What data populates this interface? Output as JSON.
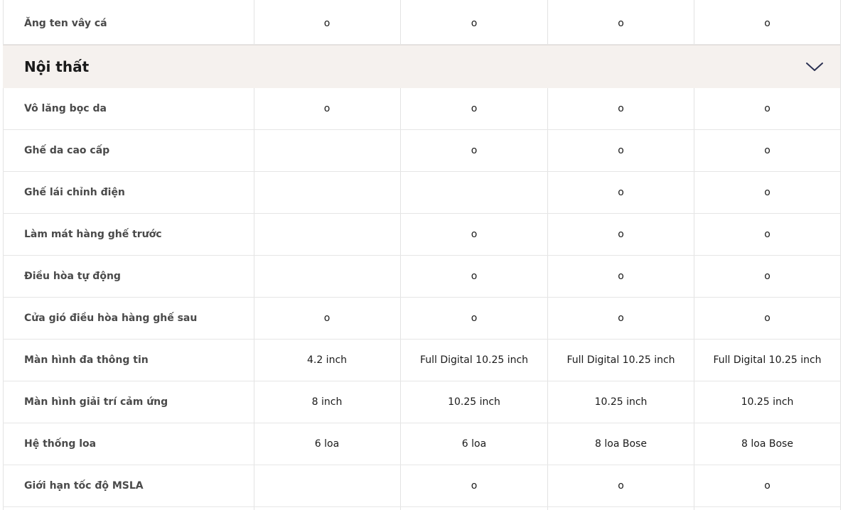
{
  "top_row": {
    "label": "Ăng ten vây cá",
    "values": [
      "o",
      "o",
      "o",
      "o"
    ]
  },
  "section": {
    "title": "Nội thất",
    "toggle_icon": "chevron-down-icon",
    "accent": "#2b3152"
  },
  "rows": [
    {
      "label": "Vô lăng bọc da",
      "values": [
        "o",
        "o",
        "o",
        "o"
      ]
    },
    {
      "label": "Ghế da cao cấp",
      "values": [
        "",
        "o",
        "o",
        "o"
      ]
    },
    {
      "label": "Ghế lái chỉnh điện",
      "values": [
        "",
        "",
        "o",
        "o"
      ]
    },
    {
      "label": "Làm mát hàng ghế trước",
      "values": [
        "",
        "o",
        "o",
        "o"
      ]
    },
    {
      "label": "Điều hòa tự động",
      "values": [
        "",
        "o",
        "o",
        "o"
      ]
    },
    {
      "label": "Cửa gió điều hòa hàng ghế sau",
      "values": [
        "o",
        "o",
        "o",
        "o"
      ]
    },
    {
      "label": "Màn hình đa thông tin",
      "values": [
        "4.2 inch",
        "Full Digital 10.25 inch",
        "Full Digital 10.25 inch",
        "Full Digital 10.25 inch"
      ]
    },
    {
      "label": "Màn hình giải trí cảm ứng",
      "values": [
        "8 inch",
        "10.25 inch",
        "10.25 inch",
        "10.25 inch"
      ]
    },
    {
      "label": "Hệ thống loa",
      "values": [
        "6 loa",
        "6 loa",
        "8 loa Bose",
        "8 loa Bose"
      ]
    },
    {
      "label": "Giới hạn tốc độ MSLA",
      "values": [
        "",
        "o",
        "o",
        "o"
      ]
    }
  ]
}
